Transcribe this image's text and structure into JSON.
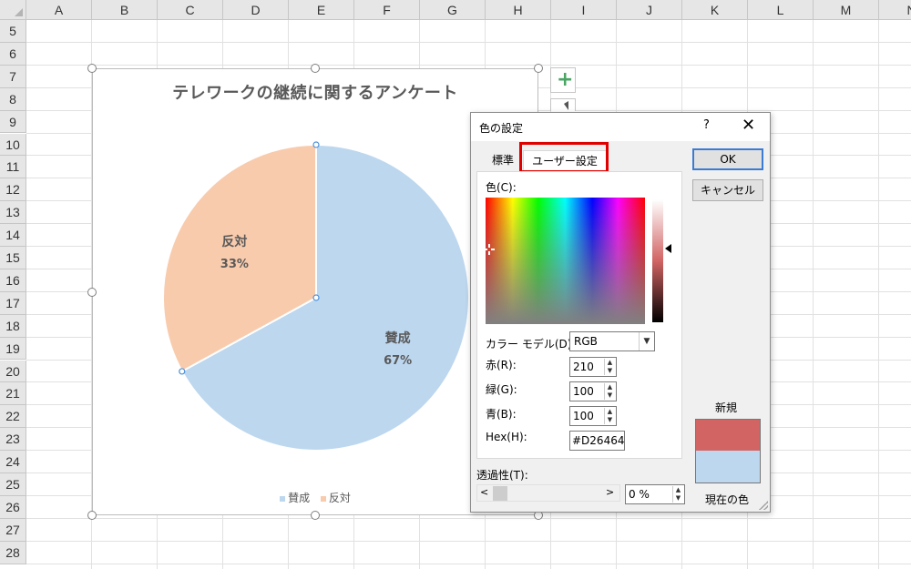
{
  "spreadsheet": {
    "columns": [
      "A",
      "B",
      "C",
      "D",
      "E",
      "F",
      "G",
      "H",
      "I",
      "J",
      "K",
      "L",
      "M",
      "N"
    ],
    "rows": [
      "5",
      "6",
      "7",
      "8",
      "9",
      "10",
      "11",
      "12",
      "13",
      "14",
      "15",
      "16",
      "17",
      "18",
      "19",
      "20",
      "21",
      "22",
      "23",
      "24",
      "25",
      "26",
      "27",
      "28"
    ]
  },
  "chart_data": {
    "type": "pie",
    "title": "テレワークの継続に関するアンケート",
    "categories": [
      "賛成",
      "反対"
    ],
    "values": [
      67,
      33
    ],
    "data_labels": [
      "67%",
      "33%"
    ],
    "colors": [
      "#bdd7ee",
      "#f8cbad"
    ],
    "legend": "bottom"
  },
  "chart_tools": {
    "add_element_glyph": "+"
  },
  "dialog": {
    "title": "色の設定",
    "help_glyph": "?",
    "close_glyph": "✕",
    "tabs": [
      {
        "label": "標準",
        "selected": false
      },
      {
        "label": "ユーザー設定",
        "selected": true
      }
    ],
    "colors_label": "色(C):",
    "color_model_label": "カラー モデル(D):",
    "color_model_value": "RGB",
    "red_label": "赤(R):",
    "red_value": "210",
    "green_label": "緑(G):",
    "green_value": "100",
    "blue_label": "青(B):",
    "blue_value": "100",
    "hex_label": "Hex(H):",
    "hex_value": "#D26464",
    "transparency_label": "透過性(T):",
    "transparency_value": "0 %",
    "ok_label": "OK",
    "cancel_label": "キャンセル",
    "new_label": "新規",
    "current_label": "現在の色",
    "new_color": "#d26464",
    "current_color": "#bdd7ee",
    "highlight_color": "#e00000"
  }
}
